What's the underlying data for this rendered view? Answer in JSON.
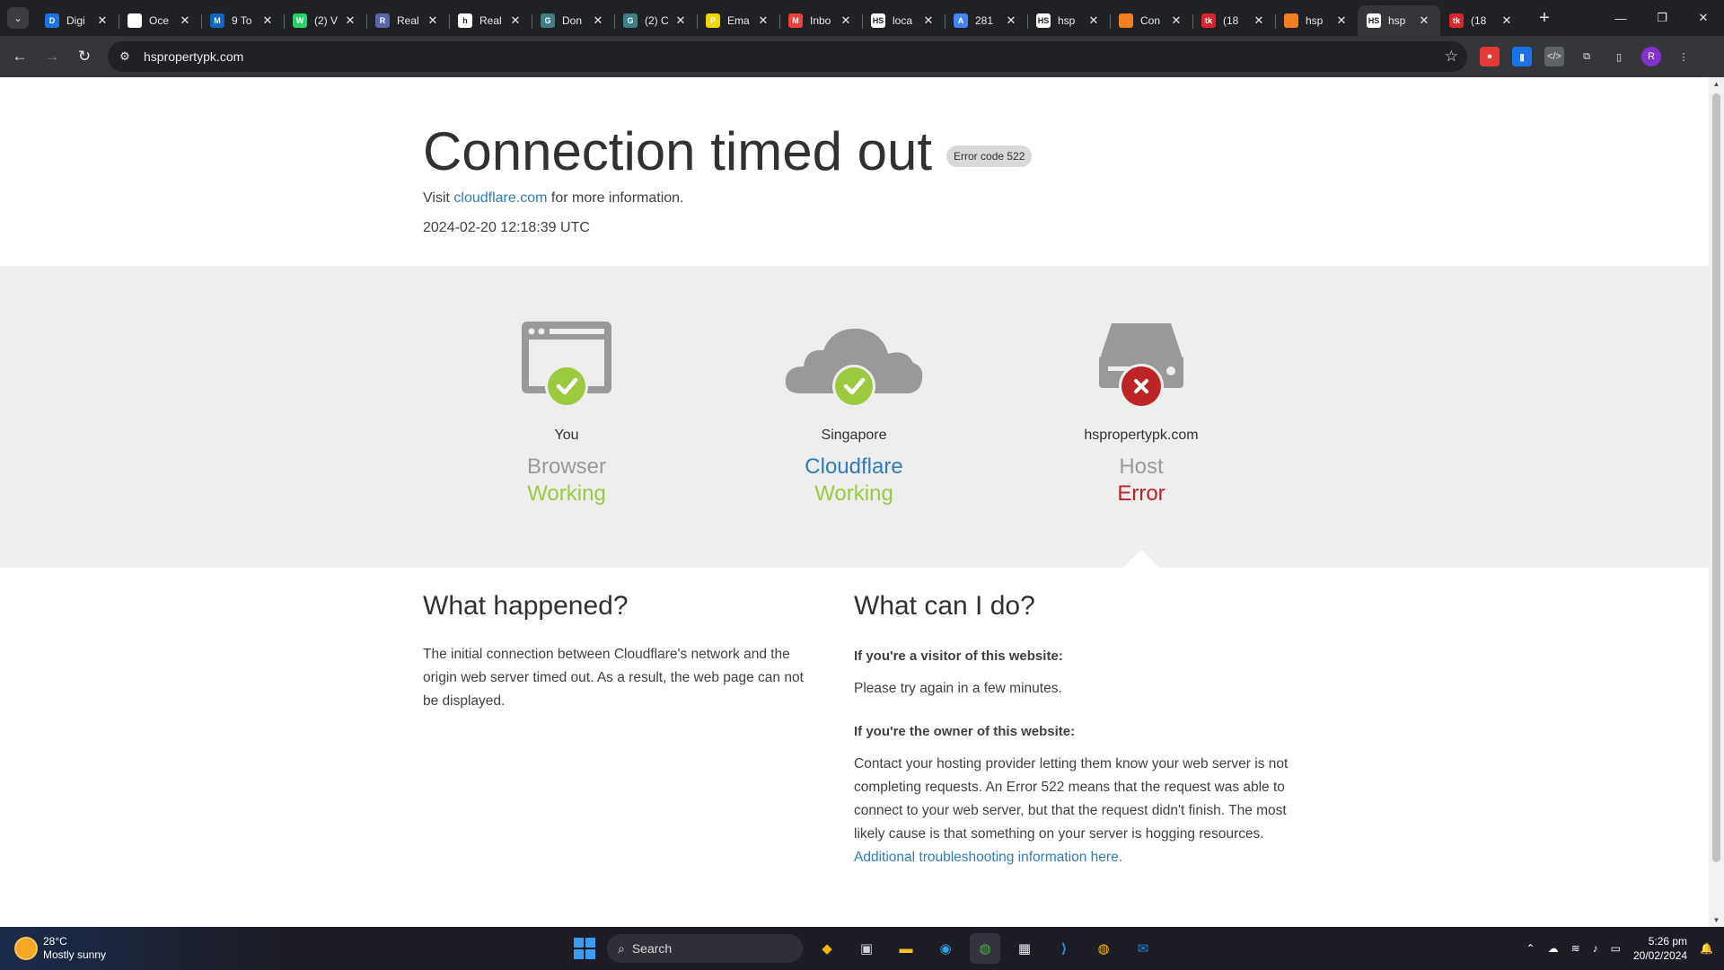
{
  "browser": {
    "tabs": [
      {
        "title": "Digi",
        "favicon_color": "#1a73e8",
        "favicon_text": "D"
      },
      {
        "title": "Oce",
        "favicon_color": "#ffffff",
        "favicon_text": ""
      },
      {
        "title": "9 To",
        "favicon_color": "#0b66c3",
        "favicon_text": "M"
      },
      {
        "title": "(2) V",
        "favicon_color": "#25d366",
        "favicon_text": "W"
      },
      {
        "title": "Real",
        "favicon_color": "#5865a8",
        "favicon_text": "R"
      },
      {
        "title": "Real",
        "favicon_color": "#ffffff",
        "favicon_text": "h"
      },
      {
        "title": "Don",
        "favicon_color": "#3f7f8a",
        "favicon_text": "G"
      },
      {
        "title": "(2) C",
        "favicon_color": "#3f7f8a",
        "favicon_text": "G"
      },
      {
        "title": "Ema",
        "favicon_color": "#f2d600",
        "favicon_text": "P"
      },
      {
        "title": "Inbo",
        "favicon_color": "#ea4335",
        "favicon_text": "M"
      },
      {
        "title": "loca",
        "favicon_color": "#ffffff",
        "favicon_text": "HS"
      },
      {
        "title": "281",
        "favicon_color": "#4285f4",
        "favicon_text": "A"
      },
      {
        "title": "hsp",
        "favicon_color": "#ffffff",
        "favicon_text": "HS"
      },
      {
        "title": "Con",
        "favicon_color": "#f38020",
        "favicon_text": ""
      },
      {
        "title": "(18",
        "favicon_color": "#d9252b",
        "favicon_text": "tk"
      },
      {
        "title": "hsp",
        "favicon_color": "#f38020",
        "favicon_text": ""
      },
      {
        "title": "hsp",
        "favicon_color": "#ffffff",
        "favicon_text": "HS",
        "active": true
      },
      {
        "title": "(18",
        "favicon_color": "#d9252b",
        "favicon_text": "tk"
      }
    ],
    "url": "hspropertypk.com",
    "profile_initial": "R"
  },
  "page": {
    "title": "Connection timed out",
    "error_code": "Error code 522",
    "visit_prefix": "Visit",
    "visit_link": "cloudflare.com",
    "visit_suffix": "for more information.",
    "timestamp": "2024-02-20 12:18:39 UTC",
    "status": [
      {
        "location": "You",
        "name": "Browser",
        "state": "Working",
        "ok": true
      },
      {
        "location": "Singapore",
        "name": "Cloudflare",
        "state": "Working",
        "ok": true
      },
      {
        "location": "hspropertypk.com",
        "name": "Host",
        "state": "Error",
        "ok": false
      }
    ],
    "what_happened": {
      "heading": "What happened?",
      "text": "The initial connection between Cloudflare's network and the origin web server timed out. As a result, the web page can not be displayed."
    },
    "what_can_i_do": {
      "heading": "What can I do?",
      "visitor_q": "If you're a visitor of this website:",
      "visitor_a": "Please try again in a few minutes.",
      "owner_q": "If you're the owner of this website:",
      "owner_a": "Contact your hosting provider letting them know your web server is not completing requests. An Error 522 means that the request was able to connect to your web server, but that the request didn't finish. The most likely cause is that something on your server is hogging resources.",
      "owner_link": "Additional troubleshooting information here."
    },
    "colors": {
      "ok": "#9bca3e",
      "error": "#bd2426",
      "link": "#2f7bbf",
      "icon_gray": "#999999"
    }
  },
  "taskbar": {
    "temperature": "28°C",
    "weather": "Mostly sunny",
    "search_placeholder": "Search",
    "time": "5:26 pm",
    "date": "20/02/2024"
  }
}
